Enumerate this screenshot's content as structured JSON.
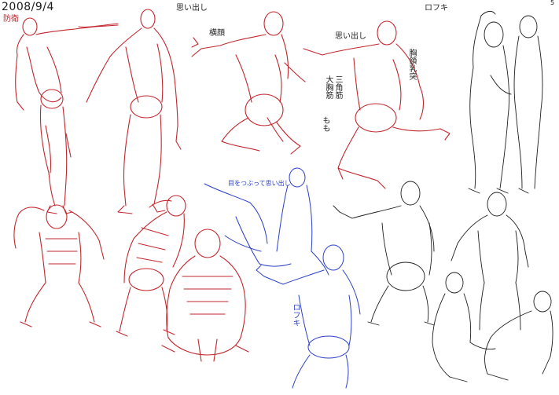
{
  "sheet": {
    "date": "2008/9/4",
    "labels": {
      "top_left_note": "防衛",
      "top_center_note": "思い出し",
      "top_right_note": "ロフキ",
      "corner_note": "5",
      "pose_note_a": "横顔",
      "pose_note_b": "思い出し",
      "muscle_note_a": "胸鎖乳突",
      "muscle_note_b": "三角筋",
      "muscle_note_c": "大胸筋",
      "muscle_note_d": "もも",
      "blue_note_a": "目をつぶって思い出し",
      "blue_note_b": "ロフキ"
    },
    "colors": {
      "red_line": "#c2272d",
      "blue_line": "#2b3fc9",
      "black_line": "#1e1e1e",
      "paper": "#ffffff"
    }
  }
}
